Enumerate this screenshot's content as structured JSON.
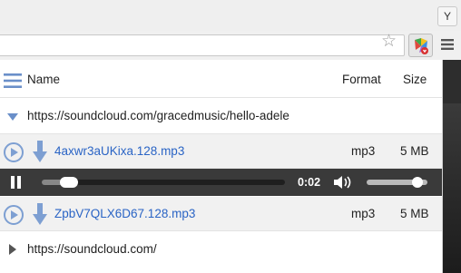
{
  "browser": {
    "profile_initial": "Y",
    "bookmark_star": "☆"
  },
  "popup": {
    "header": {
      "name": "Name",
      "format": "Format",
      "size": "Size"
    },
    "groups": [
      {
        "url": "https://soundcloud.com/gracedmusic/hello-adele",
        "expanded": true,
        "files": [
          {
            "filename": "4axwr3aUKixa.128.mp3",
            "format": "mp3",
            "size": "5 MB"
          },
          {
            "filename": "ZpbV7QLX6D67.128.mp3",
            "format": "mp3",
            "size": "5 MB"
          }
        ]
      },
      {
        "url": "https://soundcloud.com/",
        "expanded": false
      }
    ],
    "player": {
      "time": "0:02",
      "progress_fraction": 0.08,
      "volume_fraction": 0.9
    }
  },
  "colors": {
    "link": "#2a64c5",
    "icon_blue": "#7d9fd2",
    "player_bg": "#3a3a3a"
  }
}
